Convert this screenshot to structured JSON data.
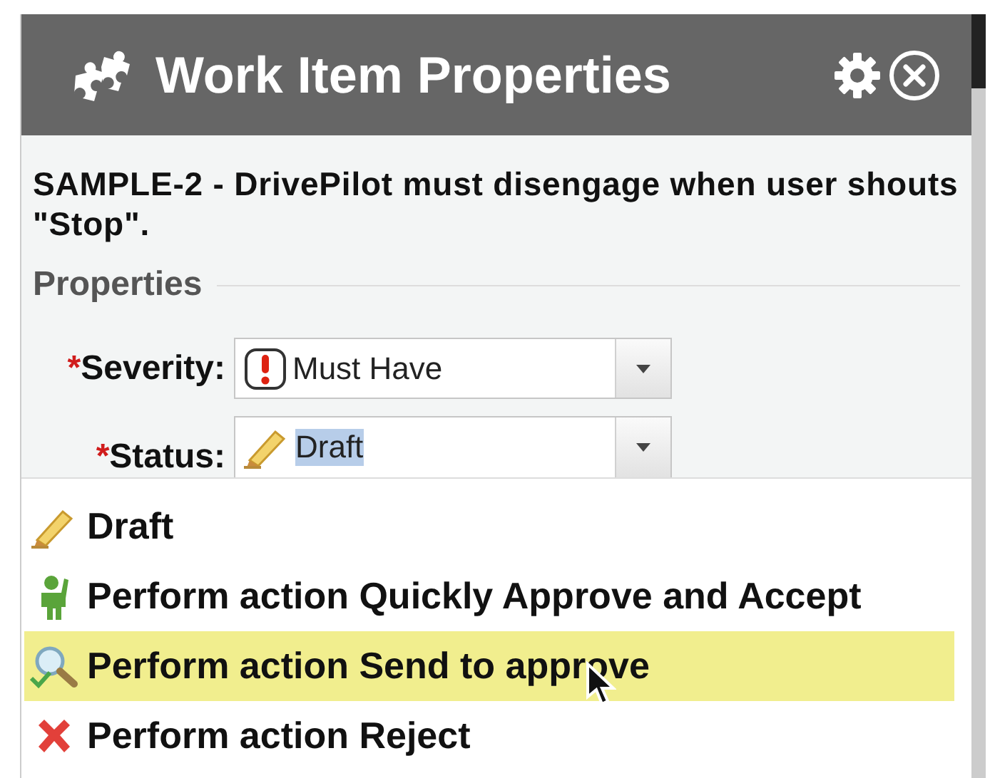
{
  "window": {
    "title": "Work Item Properties"
  },
  "summary": "SAMPLE-2 - DrivePilot must disengage when user shouts \"Stop\".",
  "section": "Properties",
  "fields": [
    {
      "required_mark": "*",
      "label": "Severity:",
      "value": "Must Have",
      "kind": "exclamation",
      "value_highlighted": false
    },
    {
      "required_mark": "*",
      "label": "Status:",
      "value": "Draft",
      "kind": "pencil",
      "value_highlighted": true
    }
  ],
  "menu": {
    "items": [
      {
        "label": "Draft",
        "kind": "pencil",
        "selected": false
      },
      {
        "label": "Perform action Quickly Approve and Accept",
        "kind": "person",
        "selected": false
      },
      {
        "label": "Perform action Send to approve",
        "kind": "magnifier",
        "selected": true
      },
      {
        "label": "Perform action Reject",
        "kind": "cross",
        "selected": false
      }
    ]
  }
}
